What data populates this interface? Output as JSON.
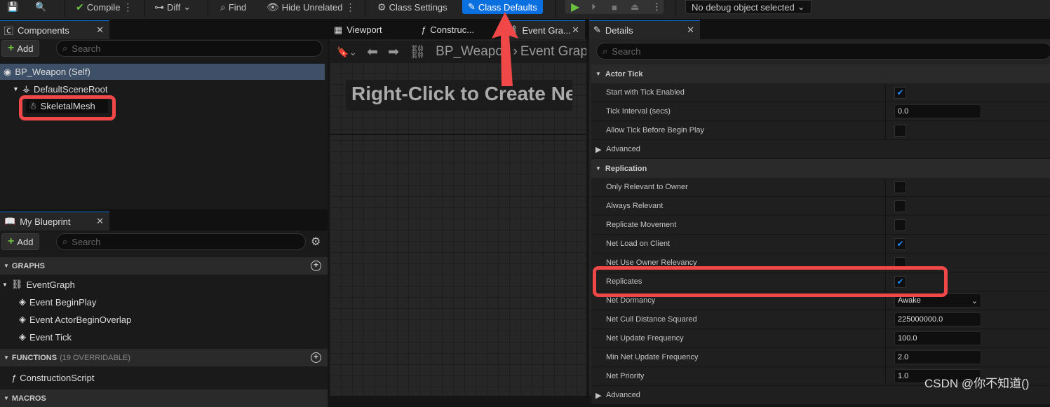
{
  "toolbar": {
    "compile": "Compile",
    "diff": "Diff",
    "find": "Find",
    "hide_unrelated": "Hide Unrelated",
    "class_settings": "Class Settings",
    "class_defaults": "Class Defaults",
    "debug_object": "No debug object selected"
  },
  "components": {
    "tab": "Components",
    "add": "Add",
    "search_placeholder": "Search",
    "tree": [
      "BP_Weapon (Self)",
      "DefaultSceneRoot",
      "SkeletalMesh"
    ]
  },
  "my_blueprint": {
    "tab": "My Blueprint",
    "add": "Add",
    "search_placeholder": "Search",
    "graphs_header": "GRAPHS",
    "event_graph": "EventGraph",
    "events": [
      "Event BeginPlay",
      "Event ActorBeginOverlap",
      "Event Tick"
    ],
    "functions_header": "FUNCTIONS",
    "functions_count": "(19 OVERRIDABLE)",
    "construction_script": "ConstructionScript",
    "macros_header": "MACROS"
  },
  "graph": {
    "tabs": [
      "Viewport",
      "Construc...",
      "Event Gra..."
    ],
    "breadcrumb": [
      "BP_Weapon",
      "Event Graph"
    ],
    "hint": "Right-Click to Create Ne"
  },
  "details": {
    "tab": "Details",
    "search_placeholder": "Search",
    "actor_tick": {
      "header": "Actor Tick",
      "rows": [
        {
          "label": "Start with Tick Enabled",
          "checked": true
        },
        {
          "label": "Tick Interval (secs)",
          "value": "0.0"
        },
        {
          "label": "Allow Tick Before Begin Play",
          "checked": false
        }
      ],
      "advanced": "Advanced"
    },
    "replication": {
      "header": "Replication",
      "rows": [
        {
          "label": "Only Relevant to Owner",
          "checked": false
        },
        {
          "label": "Always Relevant",
          "checked": false
        },
        {
          "label": "Replicate Movement",
          "checked": false
        },
        {
          "label": "Net Load on Client",
          "checked": true
        },
        {
          "label": "Net Use Owner Relevancy",
          "checked": false
        },
        {
          "label": "Replicates",
          "checked": true
        },
        {
          "label": "Net Dormancy",
          "value": "Awake"
        },
        {
          "label": "Net Cull Distance Squared",
          "value": "225000000.0"
        },
        {
          "label": "Net Update Frequency",
          "value": "100.0"
        },
        {
          "label": "Min Net Update Frequency",
          "value": "2.0"
        },
        {
          "label": "Net Priority",
          "value": "1.0"
        }
      ],
      "advanced": "Advanced"
    }
  },
  "watermark": "CSDN @你不知道()",
  "colors": {
    "accent": "#0a70e0",
    "annotation": "#f04848",
    "play": "#6ac13f"
  }
}
